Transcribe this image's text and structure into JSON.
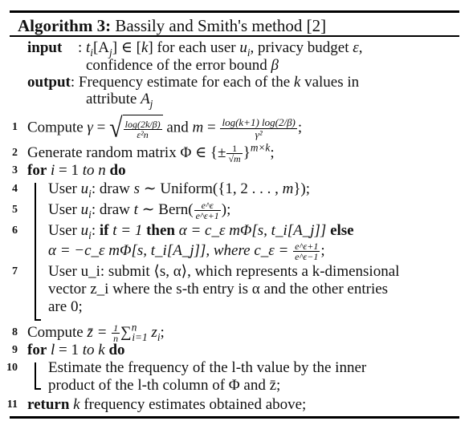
{
  "algorithm": {
    "title_label": "Algorithm 3:",
    "title_text": "Bassily and Smith's method [2]",
    "input_label": "input",
    "input_sep": ":",
    "input_line1_parts": [
      "t",
      "i",
      "[A",
      "j",
      "] ∈ [",
      "k",
      "] for each user ",
      "u",
      "i",
      ", privacy budget ",
      "ε",
      ","
    ],
    "input_line2": "confidence of the error bound",
    "input_line2_sym": "β",
    "output_label": "output",
    "output_sep": ":",
    "output_line1": "Frequency estimate for each of the",
    "output_line1_k": "k",
    "output_line1_tail": "values in",
    "output_line2": "attribute",
    "output_line2_sym": "A",
    "output_line2_sub": "j",
    "lines": [
      {
        "num": "1",
        "text": "Compute",
        "gamma": "γ",
        "eq": "=",
        "sqrt_num": "log(2k/β)",
        "sqrt_den": "ε²n",
        "and": "and",
        "m": "m",
        "m_num": "log(k+1) log(2/β)",
        "m_den": "γ²",
        "end": ";"
      },
      {
        "num": "2",
        "text": "Generate random matrix",
        "phi": "Φ ∈ {±",
        "frac_num": "1",
        "frac_den": "√m",
        "close": "}",
        "sup": "m×k",
        "end": ";"
      },
      {
        "num": "3",
        "kw_for": "for",
        "var": "i",
        "eq": "= 1",
        "to": "to",
        "n": "n",
        "kw_do": "do"
      },
      {
        "num": "4",
        "user": "User",
        "u": "u",
        "i": "i",
        "text": ": draw",
        "s": "s",
        "tail": "∼ Uniform({1, 2 . . . ,",
        "m": "m",
        "close": "});"
      },
      {
        "num": "5",
        "user": "User",
        "u": "u",
        "i": "i",
        "text": ": draw",
        "t": "t",
        "tail": "∼ Bern(",
        "num_top": "e^ε",
        "num_bot": "e^ε+1",
        "close": ");"
      },
      {
        "num": "6",
        "user": "User",
        "u": "u",
        "i": "i",
        "colon": ":",
        "kw_if": "if",
        "cond": "t = 1",
        "kw_then": "then",
        "expr": "α = c_ε mΦ[s, t_i[A_j]]",
        "kw_else": "else"
      },
      {
        "num": "",
        "expr": "α = −c_ε mΦ[s, t_i[A_j]], where",
        "c": "c_ε =",
        "frac_num": "e^ε+1",
        "frac_den": "e^ε−1",
        "end": ";"
      },
      {
        "num": "7",
        "line_a": "User u_i: submit ⟨s, α⟩, which represents a k-dimensional",
        "line_b": "vector z_i where the s-th entry is α and the other entries",
        "line_c": "are 0;"
      },
      {
        "num": "8",
        "text": "Compute",
        "expr": "z̄ =",
        "frac_num": "1",
        "frac_den": "n",
        "sum": "∑",
        "sum_top": "n",
        "sum_bot": "i=1",
        "tail": "z",
        "tail_sub": "i",
        "end": ";"
      },
      {
        "num": "9",
        "kw_for": "for",
        "var": "l",
        "eq": "= 1",
        "to": "to",
        "k": "k",
        "kw_do": "do"
      },
      {
        "num": "10",
        "line_a": "Estimate the frequency of the l-th value by the inner",
        "line_b": "product of the l-th column of Φ and z̄;"
      },
      {
        "num": "11",
        "kw_return": "return",
        "k": "k",
        "text": "frequency estimates obtained above;"
      }
    ]
  }
}
